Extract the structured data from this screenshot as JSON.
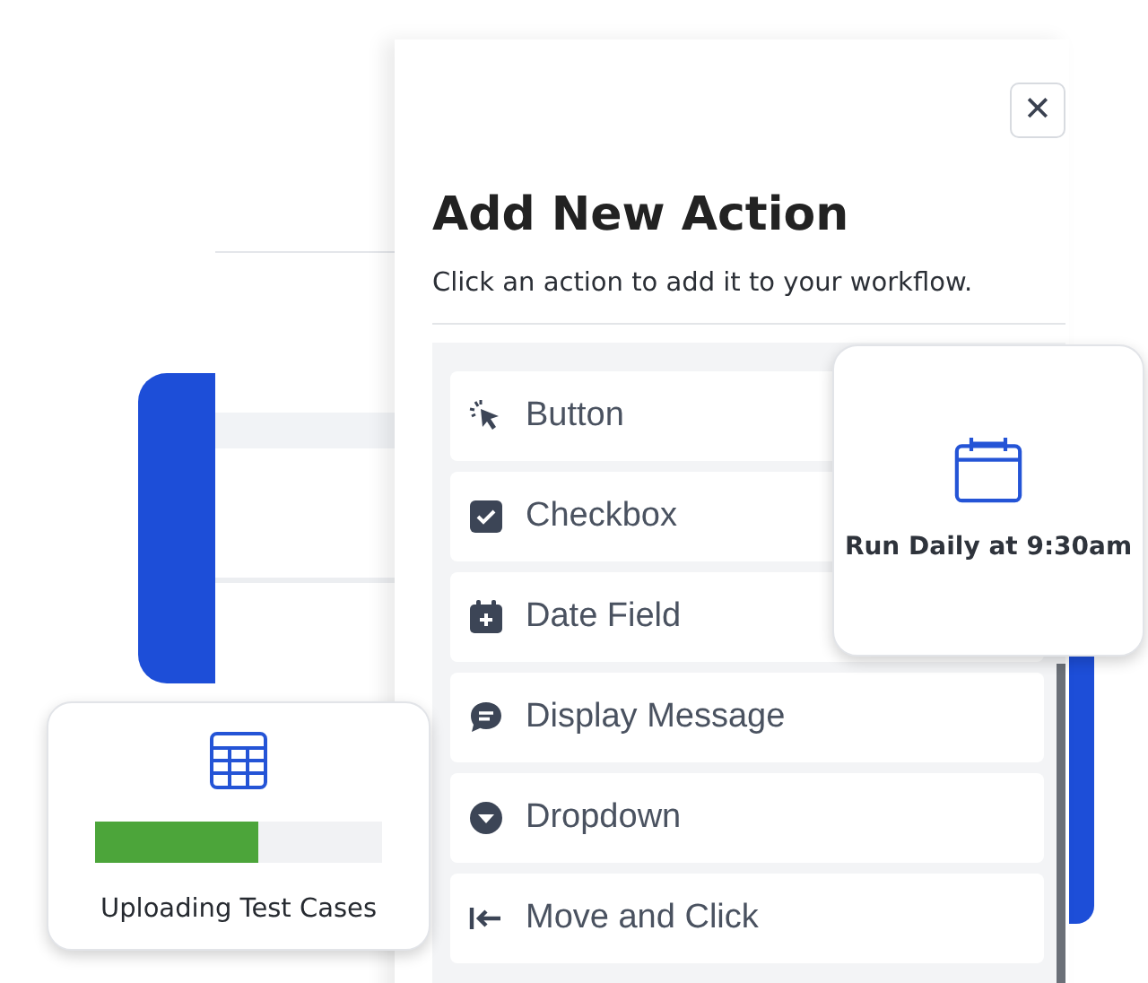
{
  "dialog": {
    "title": "Add New Action",
    "subtitle": "Click an action to add it to your workflow.",
    "close_label": "✕"
  },
  "actions": [
    {
      "kind": "button",
      "label": "Button"
    },
    {
      "kind": "checkbox",
      "label": "Checkbox"
    },
    {
      "kind": "date",
      "label": "Date Field"
    },
    {
      "kind": "message",
      "label": "Display Message"
    },
    {
      "kind": "dropdown",
      "label": "Dropdown"
    },
    {
      "kind": "move",
      "label": "Move and Click"
    }
  ],
  "schedule_card": {
    "label": "Run Daily at 9:30am"
  },
  "upload_card": {
    "label": "Uploading Test Cases",
    "level": 0.57
  }
}
